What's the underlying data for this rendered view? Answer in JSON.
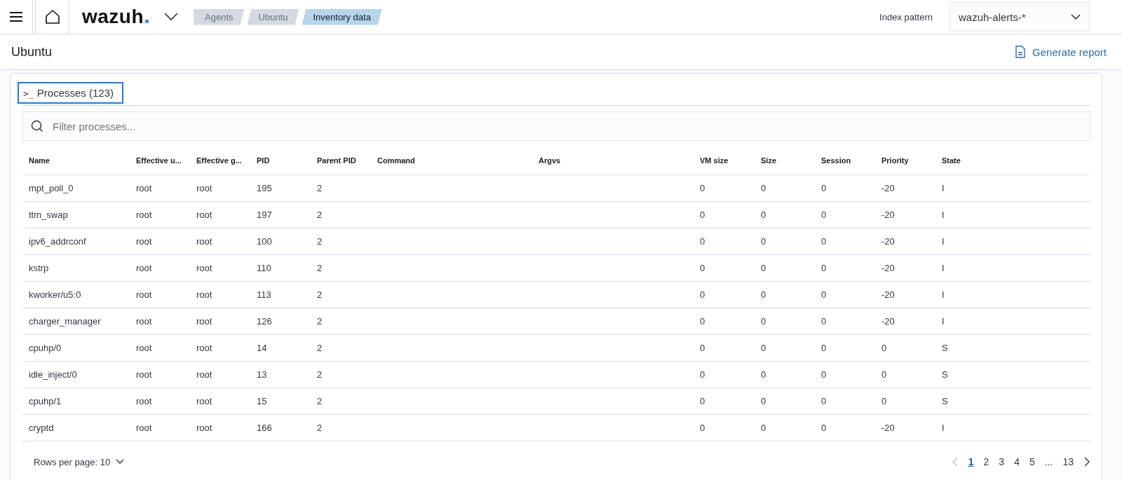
{
  "header": {
    "logo": "wazuh",
    "breadcrumbs": [
      {
        "label": "Agents",
        "selected": false
      },
      {
        "label": "Ubuntu",
        "selected": false
      },
      {
        "label": "Inventory data",
        "selected": true
      }
    ],
    "index_pattern_label": "Index pattern",
    "index_pattern_value": "wazuh-alerts-*"
  },
  "page": {
    "title": "Ubuntu",
    "report_button": "Generate report"
  },
  "panel": {
    "title_icon": ">_",
    "title": "Processes (123)",
    "search": {
      "placeholder": "Filter processes..."
    },
    "table": {
      "columns": [
        "Name",
        "Effective u...",
        "Effective g...",
        "PID",
        "Parent PID",
        "Command",
        "Argvs",
        "VM size",
        "Size",
        "Session",
        "Priority",
        "State"
      ],
      "rows": [
        [
          "mpt_poll_0",
          "root",
          "root",
          "195",
          "2",
          "",
          "",
          "0",
          "0",
          "0",
          "-20",
          "I"
        ],
        [
          "ttm_swap",
          "root",
          "root",
          "197",
          "2",
          "",
          "",
          "0",
          "0",
          "0",
          "-20",
          "I"
        ],
        [
          "ipv6_addrconf",
          "root",
          "root",
          "100",
          "2",
          "",
          "",
          "0",
          "0",
          "0",
          "-20",
          "I"
        ],
        [
          "kstrp",
          "root",
          "root",
          "110",
          "2",
          "",
          "",
          "0",
          "0",
          "0",
          "-20",
          "I"
        ],
        [
          "kworker/u5:0",
          "root",
          "root",
          "113",
          "2",
          "",
          "",
          "0",
          "0",
          "0",
          "-20",
          "I"
        ],
        [
          "charger_manager",
          "root",
          "root",
          "126",
          "2",
          "",
          "",
          "0",
          "0",
          "0",
          "-20",
          "I"
        ],
        [
          "cpuhp/0",
          "root",
          "root",
          "14",
          "2",
          "",
          "",
          "0",
          "0",
          "0",
          "0",
          "S"
        ],
        [
          "idle_inject/0",
          "root",
          "root",
          "13",
          "2",
          "",
          "",
          "0",
          "0",
          "0",
          "0",
          "S"
        ],
        [
          "cpuhp/1",
          "root",
          "root",
          "15",
          "2",
          "",
          "",
          "0",
          "0",
          "0",
          "0",
          "S"
        ],
        [
          "cryptd",
          "root",
          "root",
          "166",
          "2",
          "",
          "",
          "0",
          "0",
          "0",
          "-20",
          "I"
        ]
      ]
    },
    "rows_per_page": "Rows per page: 10",
    "pagination": {
      "prev_disabled": true,
      "pages": [
        {
          "label": "1",
          "selected": true
        },
        {
          "label": "2",
          "selected": false
        },
        {
          "label": "3",
          "selected": false
        },
        {
          "label": "4",
          "selected": false
        },
        {
          "label": "5",
          "selected": false
        },
        {
          "label": "...",
          "selected": false
        },
        {
          "label": "13",
          "selected": false
        }
      ]
    }
  }
}
